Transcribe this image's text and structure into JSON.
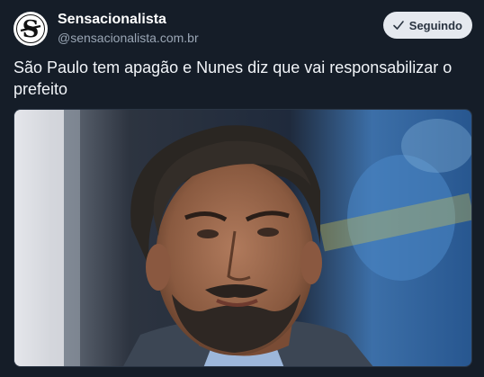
{
  "post": {
    "author": {
      "display_name": "Sensacionalista",
      "handle": "@sensacionalista.com.br",
      "avatar_icon": "sensacionalista-logo"
    },
    "follow_button": {
      "label": "Seguindo",
      "icon": "check-icon"
    },
    "text": "São Paulo tem apagão e Nunes diz que vai responsabilizar o prefeito",
    "media": {
      "type": "photo"
    }
  },
  "colors": {
    "background": "#151d28",
    "handle": "#9aa6b5",
    "button_bg": "#e5e9ef",
    "button_text": "#2a3441"
  }
}
